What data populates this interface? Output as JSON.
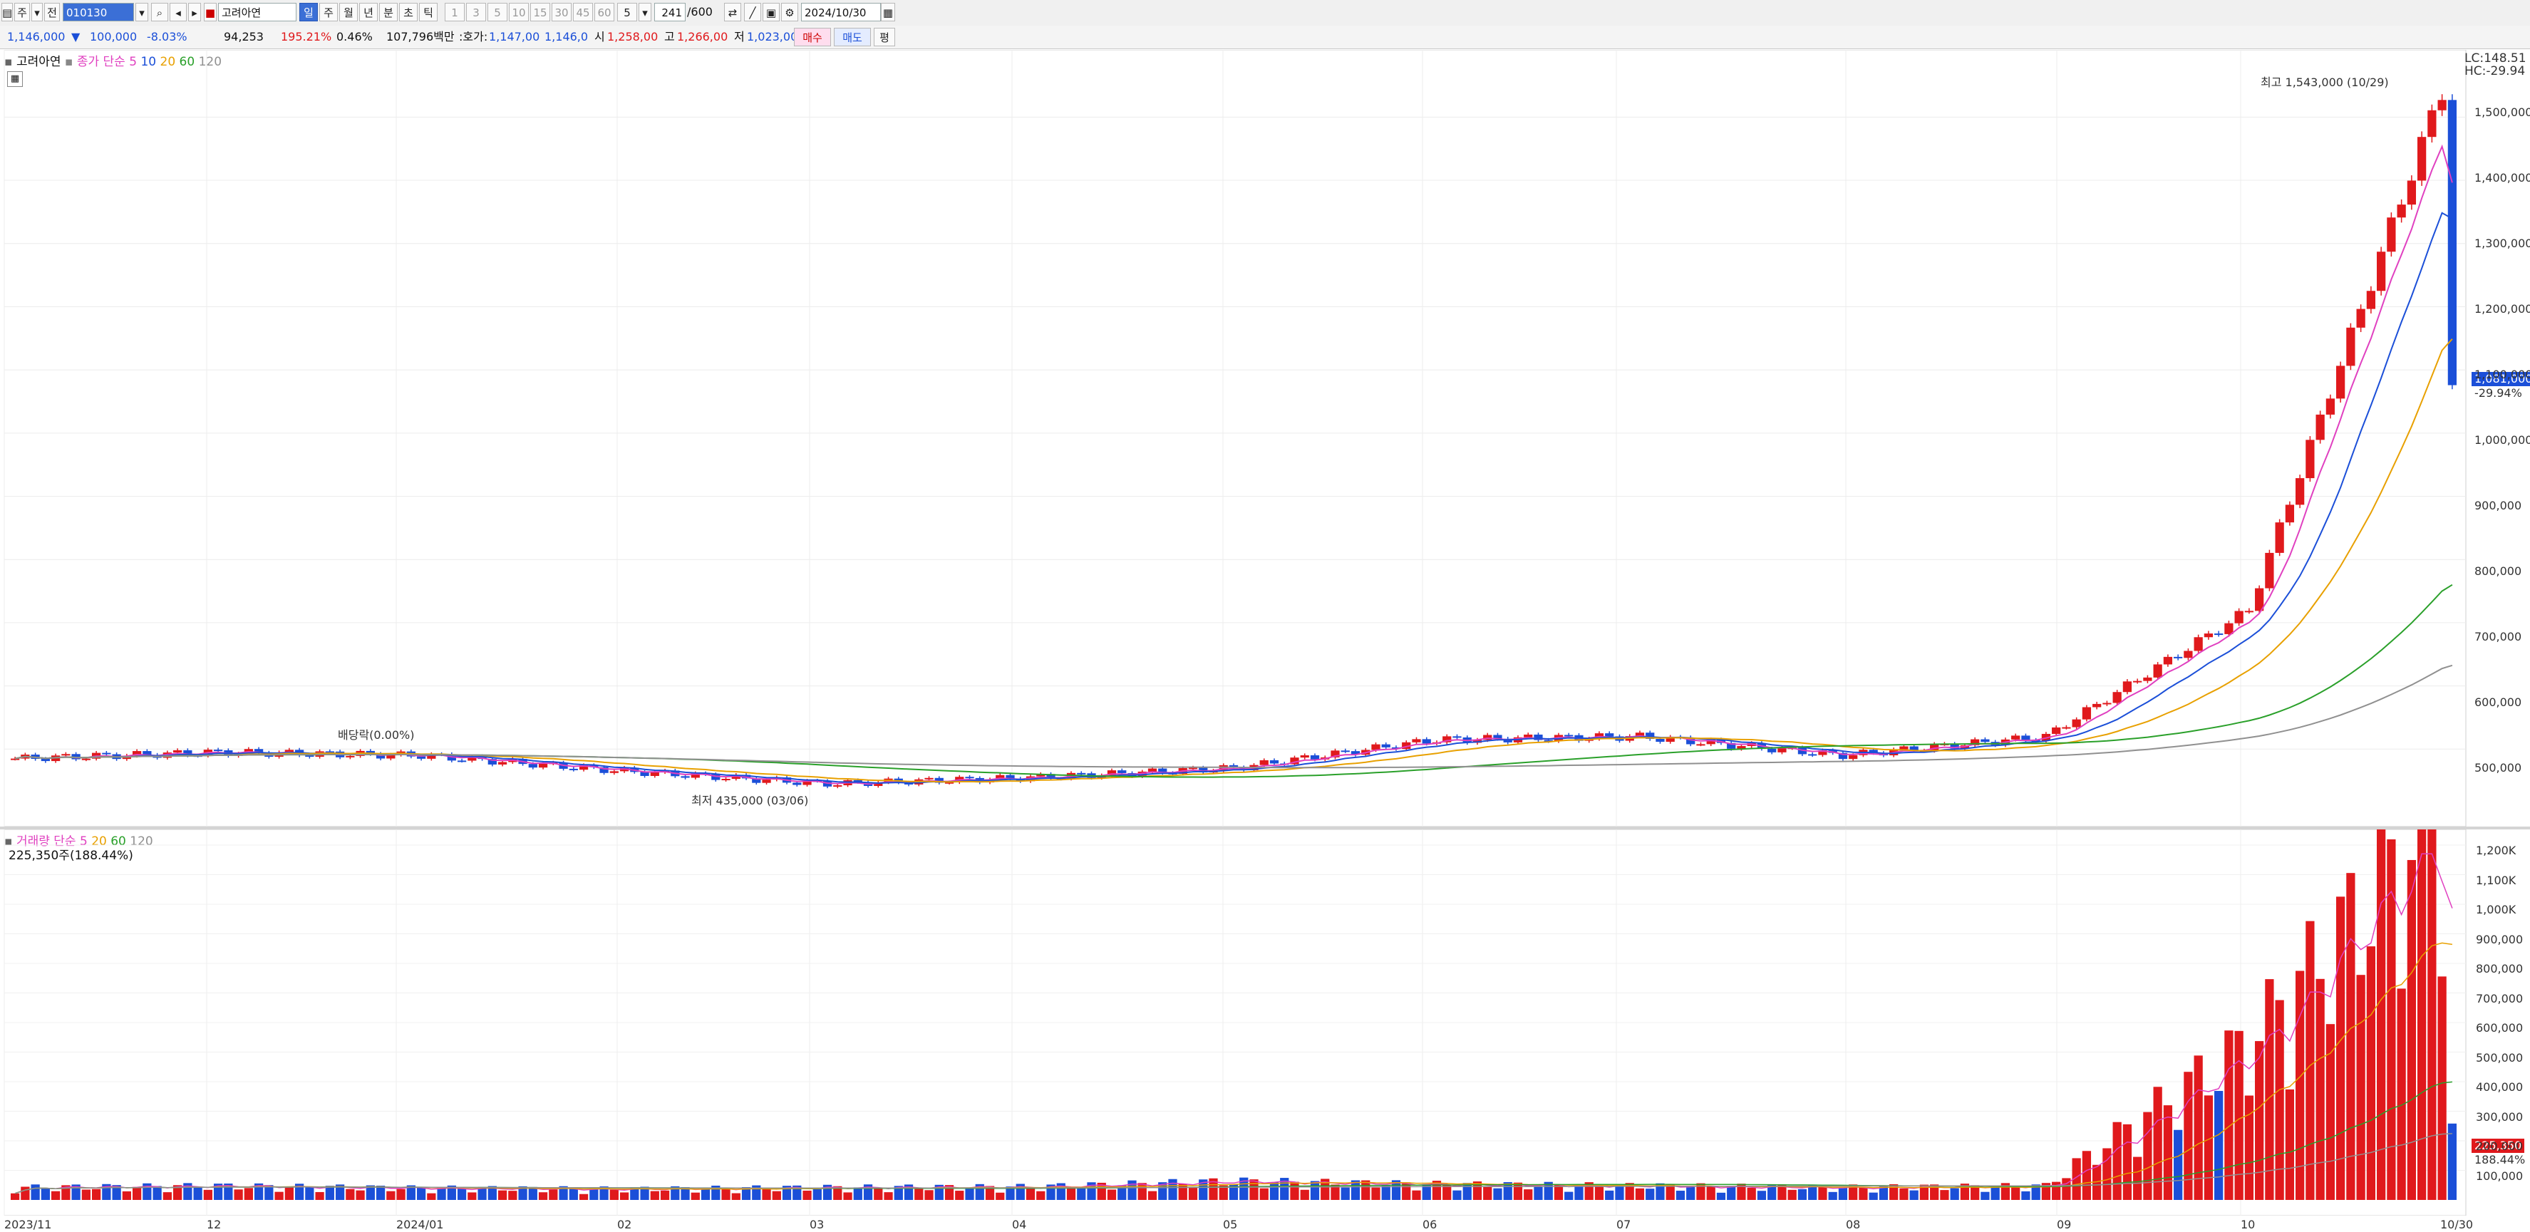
{
  "toolbar": {
    "type_label": "주",
    "prev_label": "전",
    "code": "010130",
    "stock_name": "고려아연",
    "period_tabs": [
      "일",
      "주",
      "월",
      "년",
      "분",
      "초",
      "틱"
    ],
    "period_selected": "일",
    "interval_tabs": [
      "1",
      "3",
      "5",
      "10",
      "15",
      "30",
      "45",
      "60"
    ],
    "interval_value": "5",
    "count": "241",
    "count_total": "/600",
    "date": "2024/10/30"
  },
  "status": {
    "price": "1,146,000",
    "change_arrow": "▼",
    "change": "100,000",
    "change_pct": "-8.03%",
    "volume": "94,253",
    "volume_ratio": "195.21%",
    "turnover": "0.46%",
    "amount": "107,796백만",
    "quote_label": "호가",
    "ask": "1,147,00",
    "bid": "1,146,0",
    "open_label": "시",
    "open": "1,258,00",
    "high_label": "고",
    "high": "1,266,00",
    "low_label": "저",
    "low": "1,023,00",
    "buy_label": "매수",
    "sell_label": "매도",
    "balance_label": "평"
  },
  "price_panel": {
    "legend_name": "고려아연",
    "legend_label": "종가 단순",
    "ma": [
      "5",
      "10",
      "20",
      "60",
      "120"
    ],
    "ma_colors": [
      "#e040c0",
      "#1b4fd8",
      "#e8a000",
      "#2aa02a",
      "#909090"
    ],
    "yaxis_ticks": [
      "1,500,000",
      "1,400,000",
      "1,300,000",
      "1,200,000",
      "1,100,000",
      "1,000,000",
      "900,000",
      "800,000",
      "700,000",
      "600,000",
      "500,000"
    ],
    "lc": "LC:148.51",
    "hc": "HC:-29.94",
    "current_price_box": "1,081,000",
    "current_pct": "-29.94%",
    "annotation_high": "최고 1,543,000 (10/29)",
    "annotation_low": "최저 435,000 (03/06)",
    "annotation_dividend": "배당락(0.00%)"
  },
  "volume_panel": {
    "legend_label": "거래량 단순",
    "ma": [
      "5",
      "20",
      "60",
      "120"
    ],
    "current_volume": "225,350주(188.44%)",
    "yaxis_ticks": [
      "1,200K",
      "1,100K",
      "1,000K",
      "900,000",
      "800,000",
      "700,000",
      "600,000",
      "500,000",
      "400,000",
      "300,000",
      "200,000",
      "100,000"
    ],
    "current_box": "225,350",
    "current_box_pct": "188.44%"
  },
  "xaxis": {
    "labels": [
      "2023/11",
      "12",
      "2024/01",
      "02",
      "03",
      "04",
      "05",
      "06",
      "07",
      "08",
      "09",
      "10",
      "10/30"
    ]
  },
  "chart_data": {
    "type": "line",
    "title": "고려아연",
    "price_series": {
      "name": "고려아연",
      "x": [
        "2023/11",
        "12",
        "2024/01",
        "02",
        "03",
        "04",
        "05",
        "06",
        "07",
        "08",
        "09",
        "10",
        "10/29",
        "10/30"
      ],
      "values": [
        485000,
        495000,
        490000,
        465000,
        445000,
        455000,
        470000,
        515000,
        520000,
        490000,
        520000,
        720000,
        1543000,
        1081000
      ]
    },
    "volume_series": {
      "name": "거래량",
      "values": [
        40000,
        45000,
        38000,
        35000,
        40000,
        42000,
        60000,
        50000,
        45000,
        40000,
        45000,
        500000,
        1230000,
        225350
      ]
    },
    "ylim": [
      400000,
      1550000
    ]
  }
}
